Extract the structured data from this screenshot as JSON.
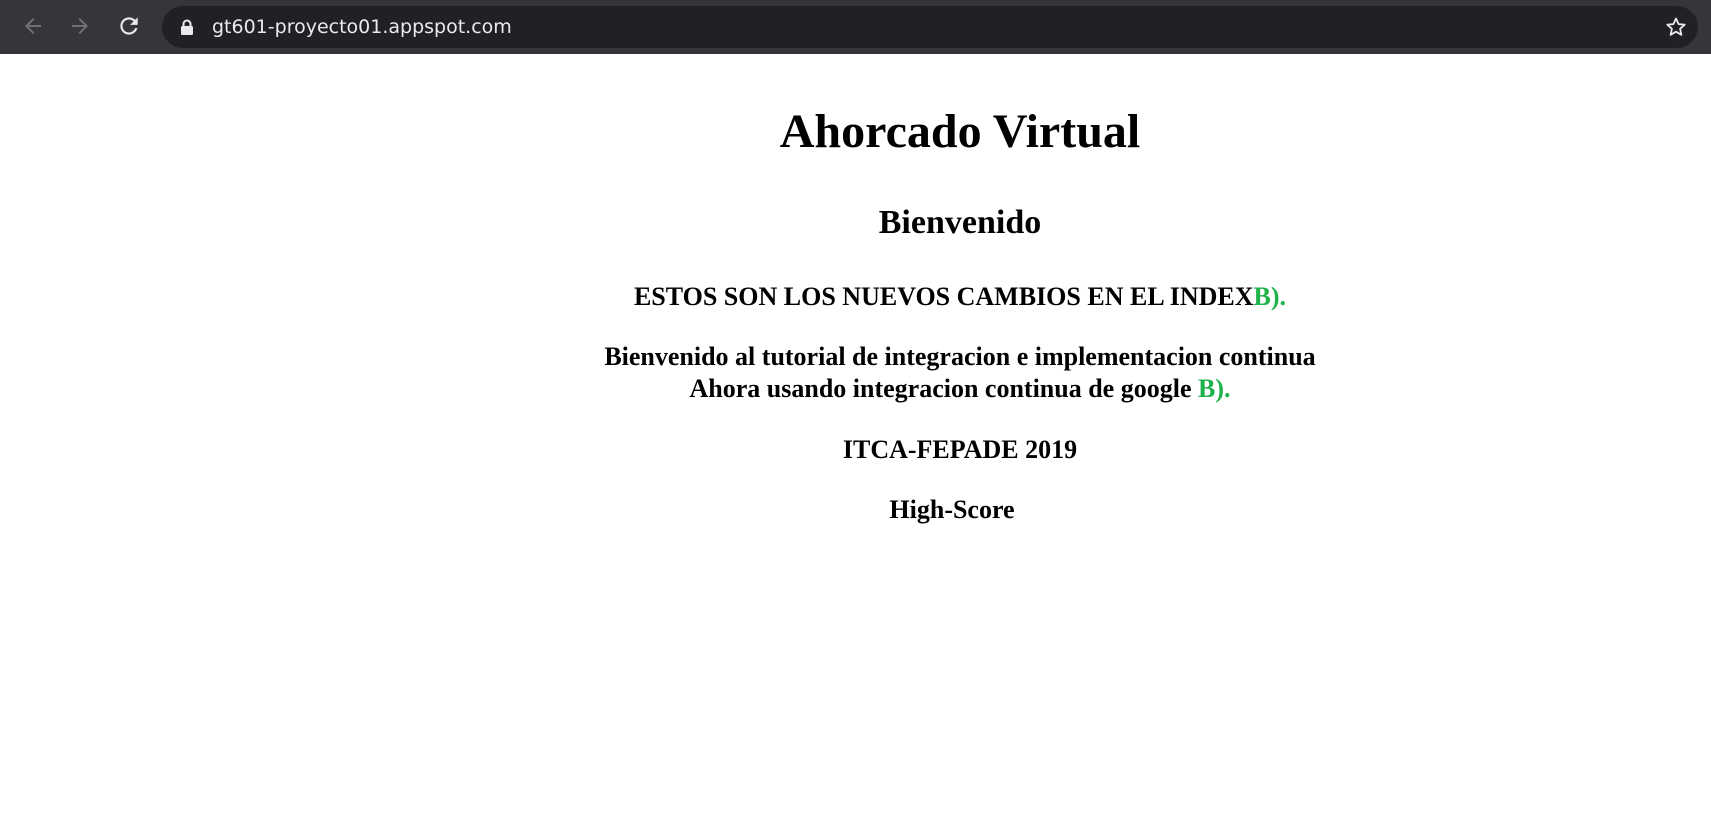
{
  "browser": {
    "url": "gt601-proyecto01.appspot.com",
    "back_icon": "arrow-left-icon",
    "forward_icon": "arrow-right-icon",
    "reload_icon": "reload-icon",
    "lock_icon": "lock-icon",
    "bookmark_icon": "star-icon",
    "toolbar_color": "#35363a",
    "omnibox_color": "#202124"
  },
  "page": {
    "title": "Ahorcado Virtual",
    "welcome": "Bienvenido",
    "changes_text": "ESTOS SON LOS NUEVOS CAMBIOS EN EL INDEX",
    "changes_suffix": "B).",
    "tutorial_line1": "Bienvenido al tutorial de integracion e implementacion continua",
    "tutorial_line2": "Ahora usando integracion continua de google ",
    "tutorial_suffix": "B).",
    "org": "ITCA-FEPADE 2019",
    "high_score": "High-Score",
    "accent_color": "#1fb14a"
  }
}
